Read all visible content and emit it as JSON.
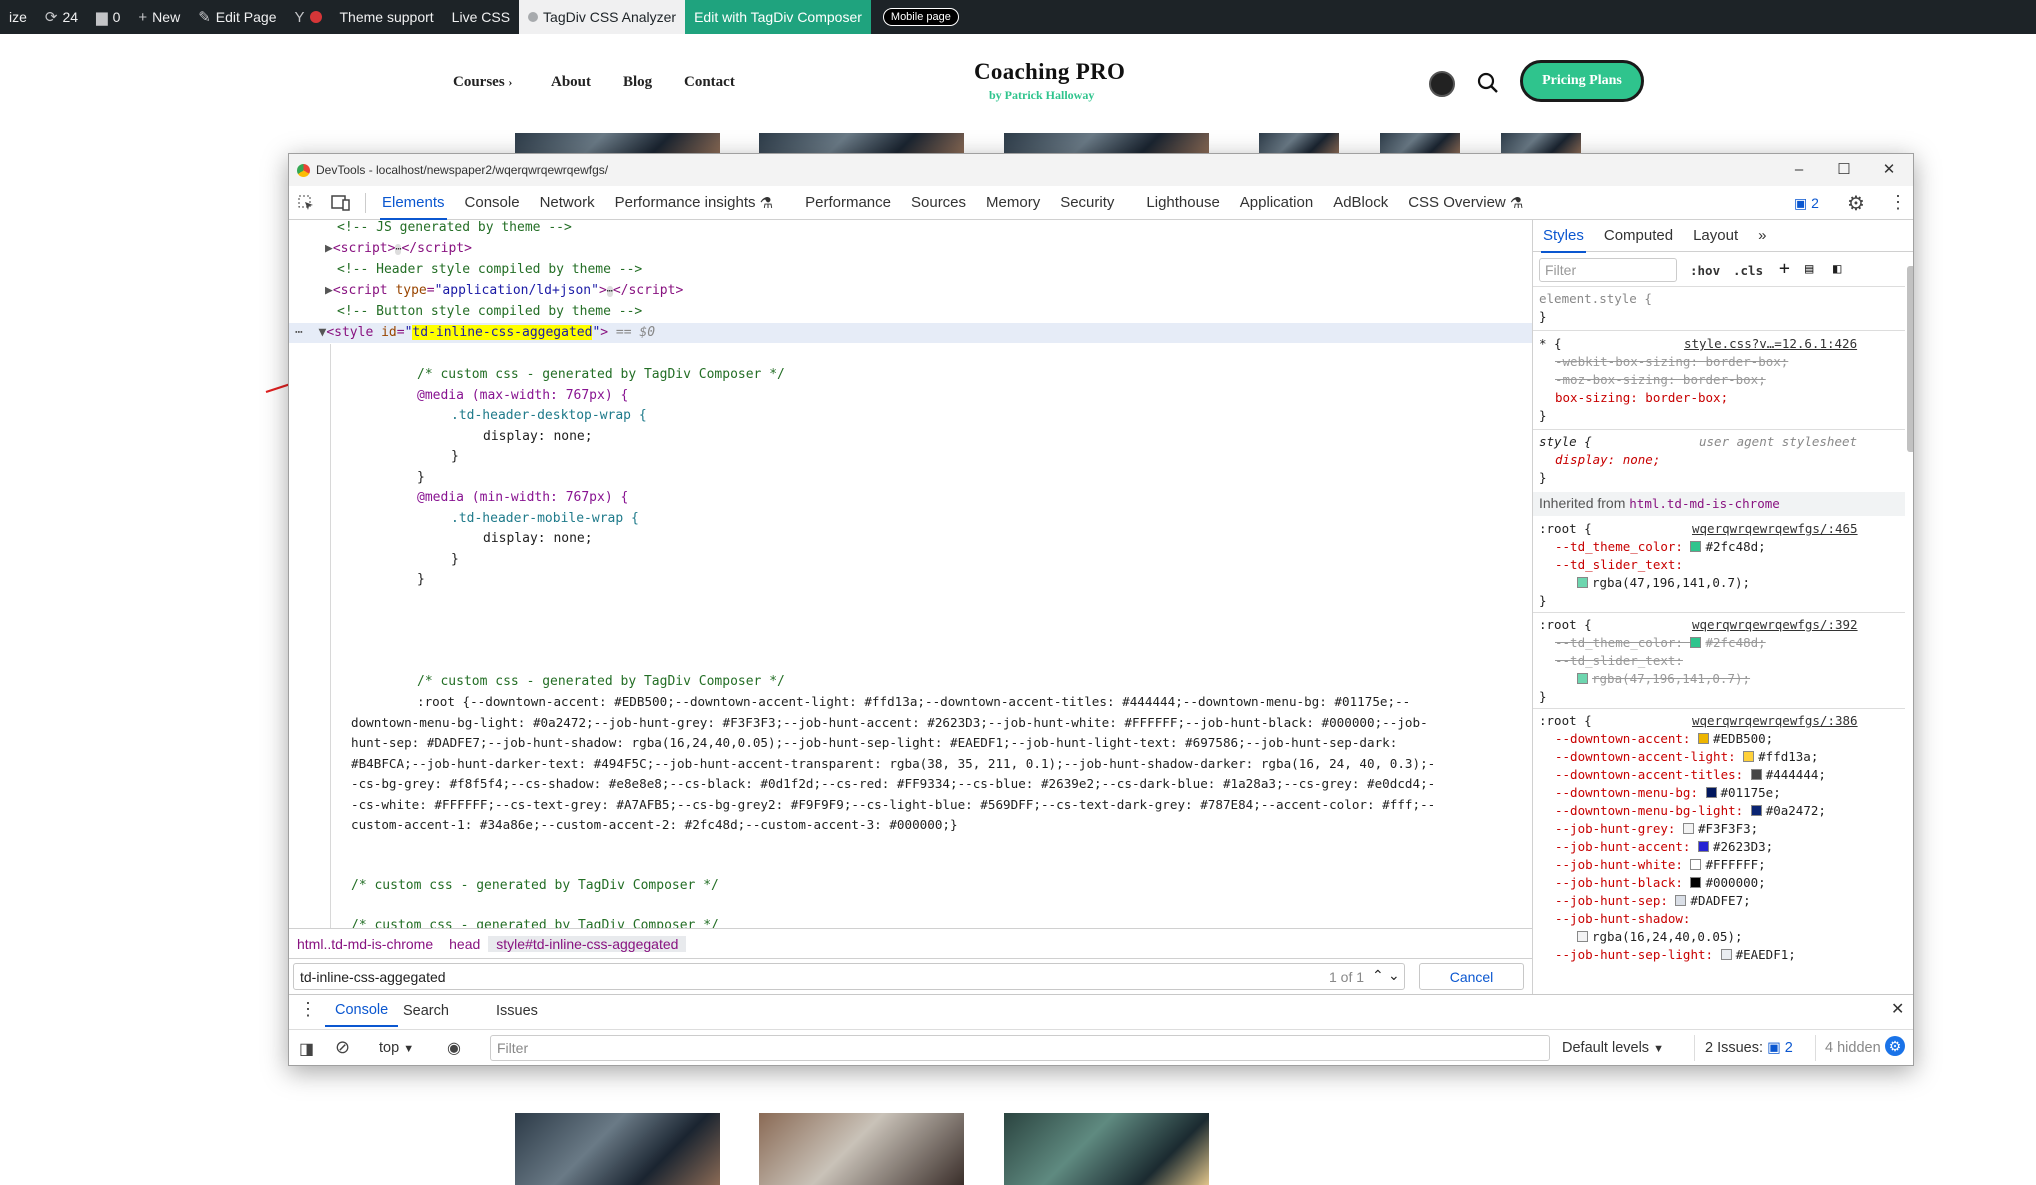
{
  "admin_bar": {
    "items": [
      {
        "name": "customize",
        "label": "ize"
      },
      {
        "name": "updates",
        "label": "24",
        "icon": "refresh-icon"
      },
      {
        "name": "comments",
        "label": "0",
        "icon": "comment-icon"
      },
      {
        "name": "new",
        "label": "New",
        "icon": "plus-icon"
      },
      {
        "name": "edit-page",
        "label": "Edit Page",
        "icon": "pencil-icon"
      },
      {
        "name": "seo",
        "label": "",
        "icon": "yoast-icon"
      },
      {
        "name": "theme-support",
        "label": "Theme support"
      },
      {
        "name": "live-css",
        "label": "Live CSS"
      },
      {
        "name": "css-analyzer",
        "label": "TagDiv CSS Analyzer"
      },
      {
        "name": "composer",
        "label": "Edit with TagDiv Composer"
      },
      {
        "name": "mobile",
        "label": "Mobile page"
      }
    ]
  },
  "site": {
    "nav": [
      "Courses",
      "About",
      "Blog",
      "Contact"
    ],
    "logo_title": "Coaching PRO",
    "logo_sub": "by Patrick Halloway",
    "pricing_button": "Pricing Plans"
  },
  "devtools": {
    "title": "DevTools - localhost/newspaper2/wqerqwrqewrqewfgs/",
    "tabs": [
      "Elements",
      "Console",
      "Network",
      "Performance insights",
      "Performance",
      "Sources",
      "Memory",
      "Security",
      "Lighthouse",
      "Application",
      "AdBlock",
      "CSS Overview"
    ],
    "active_tab": "Elements",
    "issues_badge": "2",
    "dom_lines": [
      "<!-- JS generated by theme -->",
      "<script>",
      "<!-- Header style compiled by theme -->",
      "<script type=\"application/ld+json\">",
      "<!-- Button style compiled by theme -->",
      "<style id=\"td-inline-css-aggegated\"> == $0"
    ],
    "comment_composer": "/* custom css - generated by TagDiv Composer */",
    "media1": "@media (max-width: 767px) {",
    "sel1": ".td-header-desktop-wrap {",
    "media2": "@media (min-width: 767px) {",
    "sel2": ".td-header-mobile-wrap {",
    "decl_display": "display: none;",
    "root_css": [
      ":root {--downtown-accent: #EDB500;--downtown-accent-light: #ffd13a;--downtown-accent-titles: #444444;--downtown-menu-bg: #01175e;--",
      "downtown-menu-bg-light: #0a2472;--job-hunt-grey: #F3F3F3;--job-hunt-accent: #2623D3;--job-hunt-white: #FFFFFF;--job-hunt-black: #000000;--job-",
      "hunt-sep: #DADFE7;--job-hunt-shadow: rgba(16,24,40,0.05);--job-hunt-sep-light: #EAEDF1;--job-hunt-light-text: #697586;--job-hunt-sep-dark:",
      "#B4BFCA;--job-hunt-darker-text: #494F5C;--job-hunt-accent-transparent: rgba(38, 35, 211, 0.1);--job-hunt-shadow-darker: rgba(16, 24, 40, 0.3);-",
      "-cs-bg-grey: #f8f5f4;--cs-shadow: #e8e8e8;--cs-black: #0d1f2d;--cs-red: #FF9334;--cs-blue: #2639e2;--cs-dark-blue: #1a28a3;--cs-grey: #e0dcd4;-",
      "-cs-white: #FFFFFF;--cs-text-grey: #A7AFB5;--cs-bg-grey2: #F9F9F9;--cs-light-blue: #569DFF;--cs-text-dark-grey: #787E84;--accent-color: #fff;--",
      "custom-accent-1: #34a86e;--custom-accent-2: #2fc48d;--custom-accent-3: #000000;}"
    ],
    "last_comment_partial": "/* custom css - generated by TagDiv Composer */",
    "breadcrumbs": [
      "html..td-md-is-chrome",
      "head",
      "style#td-inline-css-aggegated"
    ],
    "search_value": "td-inline-css-aggegated",
    "search_count": "1 of 1",
    "cancel": "Cancel",
    "styles_tabs": [
      "Styles",
      "Computed",
      "Layout"
    ],
    "filter_placeholder": "Filter",
    "hov": ":hov",
    "cls": ".cls",
    "element_style": "element.style {",
    "star_rule_src": "style.css?v…=12.6.1:426",
    "star_props": [
      "-webkit-box-sizing: border-box;",
      "-moz-box-sizing: border-box;",
      "box-sizing: border-box;"
    ],
    "ua_label": "user agent stylesheet",
    "ua_rule": "display: none;",
    "inherited_label": "Inherited from",
    "inherited_el": "html.td-md-is-chrome",
    "root_src1": "wqerqwrqewrqewfgs/:465",
    "root_src2": "wqerqwrqewrqewfgs/:392",
    "root_src3": "wqerqwrqewrqewfgs/:386",
    "theme_color": "--td_theme_color: ",
    "theme_color_val": "#2fc48d;",
    "slider_text": "--td_slider_text:",
    "slider_val": "rgba(47,196,141,0.7);",
    "root_vars": [
      {
        "n": "--downtown-accent:",
        "v": "#EDB500;",
        "c": "#EDB500"
      },
      {
        "n": "--downtown-accent-light:",
        "v": "#ffd13a;",
        "c": "#ffd13a"
      },
      {
        "n": "--downtown-accent-titles:",
        "v": "#444444;",
        "c": "#444444"
      },
      {
        "n": "--downtown-menu-bg:",
        "v": "#01175e;",
        "c": "#01175e"
      },
      {
        "n": "--downtown-menu-bg-light:",
        "v": "#0a2472;",
        "c": "#0a2472"
      },
      {
        "n": "--job-hunt-grey:",
        "v": "#F3F3F3;",
        "c": "#F3F3F3"
      },
      {
        "n": "--job-hunt-accent:",
        "v": "#2623D3;",
        "c": "#2623D3"
      },
      {
        "n": "--job-hunt-white:",
        "v": "#FFFFFF;",
        "c": "#FFFFFF"
      },
      {
        "n": "--job-hunt-black:",
        "v": "#000000;",
        "c": "#000000"
      },
      {
        "n": "--job-hunt-sep:",
        "v": "#DADFE7;",
        "c": "#DADFE7"
      },
      {
        "n": "--job-hunt-shadow:",
        "v": "",
        "c": ""
      },
      {
        "n": "",
        "v": "rgba(16,24,40,0.05);",
        "c": "rgba(16,24,40,0.05)"
      },
      {
        "n": "--job-hunt-sep-light:",
        "v": "#EAEDF1;",
        "c": "#EAEDF1"
      }
    ]
  },
  "console_drawer": {
    "tabs": [
      "Console",
      "Search",
      "Issues"
    ],
    "context": "top",
    "filter": "Filter",
    "levels": "Default levels",
    "issues_label": "2 Issues:",
    "issues_count": "2",
    "hidden": "4 hidden"
  }
}
